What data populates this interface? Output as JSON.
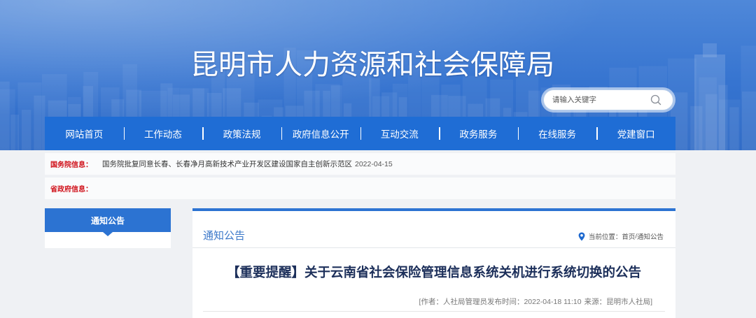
{
  "site": {
    "title": "昆明市人力资源和社会保障局"
  },
  "search": {
    "placeholder": "请输入关键字",
    "icon": "search-icon"
  },
  "nav": {
    "items": [
      {
        "label": "网站首页"
      },
      {
        "label": "工作动态"
      },
      {
        "label": "政策法规"
      },
      {
        "label": "政府信息公开"
      },
      {
        "label": "互动交流"
      },
      {
        "label": "政务服务"
      },
      {
        "label": "在线服务"
      },
      {
        "label": "党建窗口"
      }
    ]
  },
  "info": [
    {
      "label": "国务院信息：",
      "text": "国务院批复同意长春、长春净月高新技术产业开发区建设国家自主创新示范区",
      "date": "2022-04-15"
    },
    {
      "label": "省政府信息："
    }
  ],
  "sidebar": {
    "title": "通知公告"
  },
  "main": {
    "section_title": "通知公告",
    "breadcrumb": {
      "icon": "location-pin-icon",
      "label": "当前位置：",
      "items": [
        "首页",
        "通知公告"
      ],
      "separator": "/"
    },
    "article": {
      "title": "【重要提醒】关于云南省社会保险管理信息系统关机进行系统切换的公告",
      "meta": {
        "open": "[",
        "author_label": "作者：",
        "author": "人社局管理员",
        "time_label": "发布时间：",
        "time": "2022-04-18 11:10",
        "source_label": "来源：",
        "source": "昆明市人社局",
        "close": "]"
      }
    }
  },
  "colors": {
    "nav_bg": "#1f6dd5",
    "accent": "#2c73d2",
    "label_red": "#d0121b",
    "title_navy": "#1c2f5a",
    "section_blue": "#3b78c9"
  }
}
